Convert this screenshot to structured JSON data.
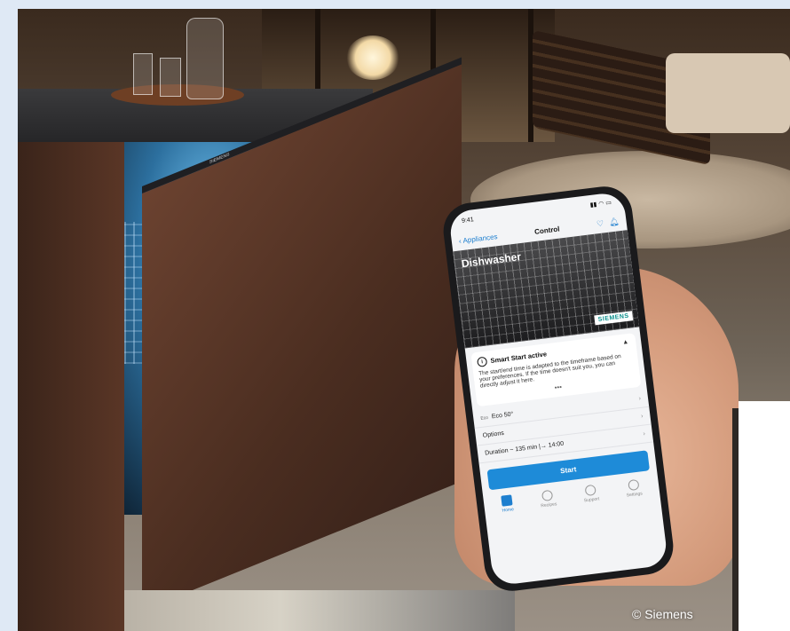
{
  "phone": {
    "time": "9:41",
    "back_label": "Appliances",
    "screen_title": "Control",
    "appliance_name": "Dishwasher",
    "brand": "SIEMENS",
    "notice": {
      "title": "Smart Start active",
      "body": "The start/end time is adapted to the timeframe based on your preferences. If the time doesn't suit you, you can directly adjust it here.",
      "more": "•••"
    },
    "program": {
      "prefix": "Eco",
      "value": "Eco 50°"
    },
    "options_label": "Options",
    "duration_label": "Duration ~ 135 min  |→  14:00",
    "start_label": "Start",
    "tabs": [
      "Home",
      "Recipes",
      "Support",
      "Settings"
    ]
  },
  "photo": {
    "credit": "© Siemens",
    "door_badge": "SIEMENS"
  }
}
